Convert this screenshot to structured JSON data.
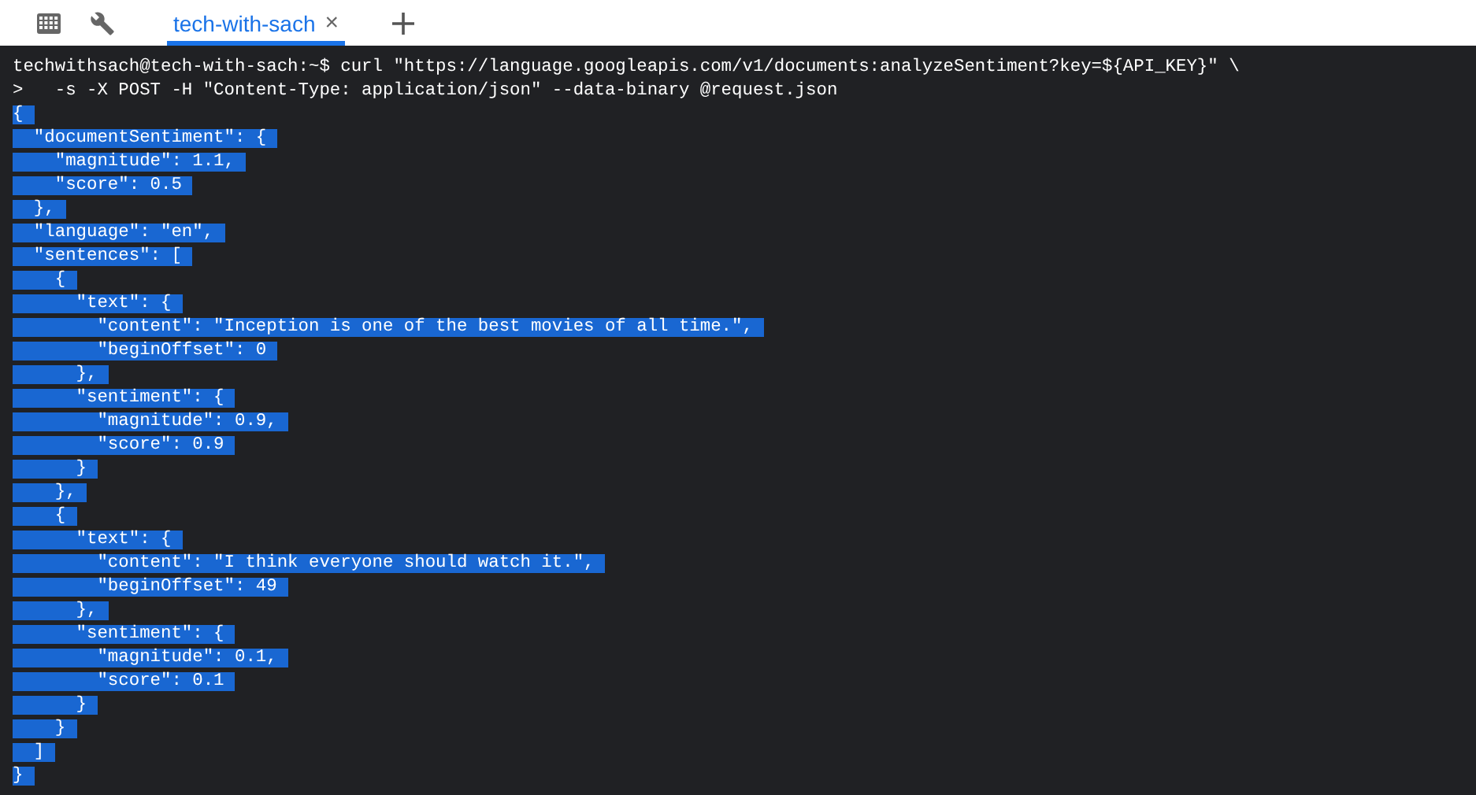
{
  "toolbar": {
    "tabs": [
      {
        "label": "tech-with-sach",
        "selected": true,
        "close": "×"
      }
    ]
  },
  "terminal": {
    "lines": [
      {
        "text": "techwithsach@tech-with-sach:~$ curl \"https://language.googleapis.com/v1/documents:analyzeSentiment?key=${API_KEY}\" \\",
        "selected": false
      },
      {
        "text": ">   -s -X POST -H \"Content-Type: application/json\" --data-binary @request.json",
        "selected": false
      },
      {
        "text": "{",
        "selected": true
      },
      {
        "text": "  \"documentSentiment\": {",
        "selected": true
      },
      {
        "text": "    \"magnitude\": 1.1,",
        "selected": true
      },
      {
        "text": "    \"score\": 0.5",
        "selected": true
      },
      {
        "text": "  },",
        "selected": true
      },
      {
        "text": "  \"language\": \"en\",",
        "selected": true
      },
      {
        "text": "  \"sentences\": [",
        "selected": true
      },
      {
        "text": "    {",
        "selected": true
      },
      {
        "text": "      \"text\": {",
        "selected": true
      },
      {
        "text": "        \"content\": \"Inception is one of the best movies of all time.\",",
        "selected": true
      },
      {
        "text": "        \"beginOffset\": 0",
        "selected": true
      },
      {
        "text": "      },",
        "selected": true
      },
      {
        "text": "      \"sentiment\": {",
        "selected": true
      },
      {
        "text": "        \"magnitude\": 0.9,",
        "selected": true
      },
      {
        "text": "        \"score\": 0.9",
        "selected": true
      },
      {
        "text": "      }",
        "selected": true
      },
      {
        "text": "    },",
        "selected": true
      },
      {
        "text": "    {",
        "selected": true
      },
      {
        "text": "      \"text\": {",
        "selected": true
      },
      {
        "text": "        \"content\": \"I think everyone should watch it.\",",
        "selected": true
      },
      {
        "text": "        \"beginOffset\": 49",
        "selected": true
      },
      {
        "text": "      },",
        "selected": true
      },
      {
        "text": "      \"sentiment\": {",
        "selected": true
      },
      {
        "text": "        \"magnitude\": 0.1,",
        "selected": true
      },
      {
        "text": "        \"score\": 0.1",
        "selected": true
      },
      {
        "text": "      }",
        "selected": true
      },
      {
        "text": "    }",
        "selected": true
      },
      {
        "text": "  ]",
        "selected": true
      },
      {
        "text": "}",
        "selected": true
      }
    ]
  }
}
